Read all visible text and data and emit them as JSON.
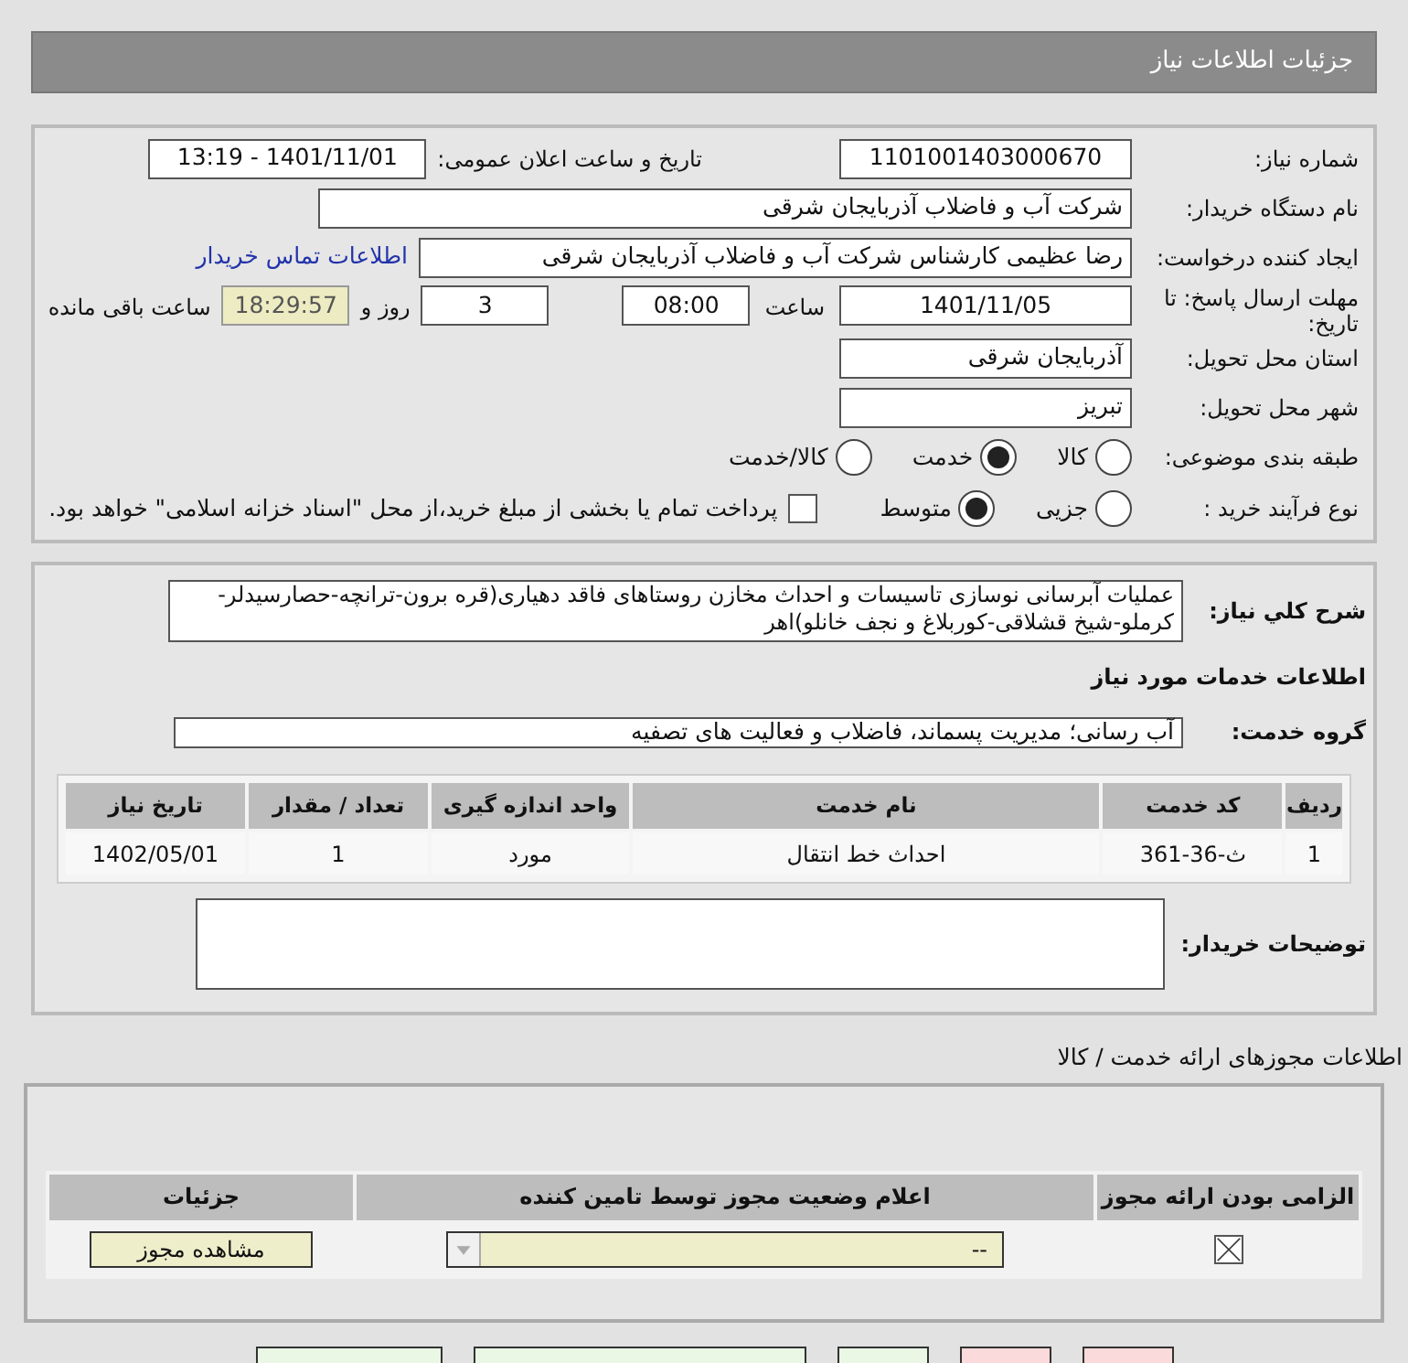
{
  "header": {
    "title": "جزئیات اطلاعات نیاز"
  },
  "summary": {
    "need_number": {
      "label": "شماره نیاز:",
      "value": "1101001403000670"
    },
    "announce": {
      "label": "تاریخ و ساعت اعلان عمومی:",
      "value": "1401/11/01 - 13:19"
    },
    "buyer": {
      "label": "نام دستگاه خریدار:",
      "value": "شرکت آب و فاضلاب آذربایجان شرقی"
    },
    "creator": {
      "label": "ایجاد کننده درخواست:",
      "value": "رضا عظیمی کارشناس شرکت آب و فاضلاب آذربایجان شرقی",
      "link": "اطلاعات تماس خریدار"
    },
    "deadline": {
      "label": "مهلت ارسال پاسخ: تا تاریخ:",
      "date": "1401/11/05",
      "time_label": "ساعت",
      "time": "08:00",
      "days": "3",
      "days_label": "روز و",
      "remaining": "18:29:57",
      "remaining_label": "ساعت باقی مانده"
    },
    "province": {
      "label": "استان محل تحویل:",
      "value": "آذربایجان شرقی"
    },
    "city": {
      "label": "شهر محل تحویل:",
      "value": "تبریز"
    },
    "category": {
      "label": "طبقه بندی موضوعی:",
      "options": [
        {
          "label": "کالا",
          "selected": false
        },
        {
          "label": "خدمت",
          "selected": true
        },
        {
          "label": "کالا/خدمت",
          "selected": false
        }
      ]
    },
    "process": {
      "label": "نوع فرآیند خرید :",
      "options": [
        {
          "label": "جزیی",
          "selected": false
        },
        {
          "label": "متوسط",
          "selected": true
        }
      ],
      "payment": {
        "checked": false,
        "label": "پرداخت تمام یا بخشی از مبلغ خرید،از محل \"اسناد خزانه اسلامی\" خواهد بود."
      }
    }
  },
  "details": {
    "description": {
      "label": "شرح کلي نياز:",
      "value": "عملیات آبرسانی نوسازی تاسیسات و احداث مخازن روستاهای فاقد دهیاری(قره برون-ترانچه-حصارسیدلر-کرملو-شیخ قشلاقی-کوربلاغ و نجف خانلو)اهر"
    },
    "services_title": "اطلاعات خدمات مورد نیاز",
    "group": {
      "label": "گروه خدمت:",
      "value": "آب رسانی؛ مدیریت پسماند، فاضلاب و فعالیت های تصفیه"
    },
    "table": {
      "columns": [
        "ردیف",
        "کد خدمت",
        "نام خدمت",
        "واحد اندازه گیری",
        "تعداد / مقدار",
        "تاریخ نیاز"
      ],
      "rows": [
        [
          "1",
          "ث-36-361",
          "احداث خط انتقال",
          "مورد",
          "1",
          "1402/05/01"
        ]
      ]
    },
    "buyer_notes": {
      "label": "توضیحات خریدار:"
    }
  },
  "licenses": {
    "title": "اطلاعات مجوزهای ارائه خدمت / کالا",
    "columns": [
      "الزامی بودن ارائه مجوز",
      "اعلام وضعیت مجوز توسط تامین کننده",
      "جزئیات"
    ],
    "rows": [
      {
        "required": true,
        "status": "--",
        "action": "مشاهده مجوز"
      }
    ]
  },
  "footer_buttons": [
    {
      "kind": "normal"
    },
    {
      "kind": "normal"
    },
    {
      "kind": "normal"
    },
    {
      "kind": "danger"
    },
    {
      "kind": "danger"
    }
  ]
}
